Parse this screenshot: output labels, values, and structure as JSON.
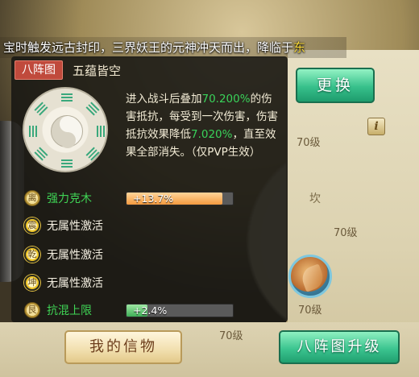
{
  "banner": {
    "text_before": "宝时触发远古封印，三界妖王的元神冲天而出，降临于",
    "text_highlight": "东"
  },
  "formation": {
    "tag": "八阵图",
    "name": "五蕴皆空"
  },
  "description": {
    "part1": "进入战斗后叠加",
    "value1": "70.200%",
    "part2": "的伤害抵抗，每受到一次伤害，伤害抵抗效果降低",
    "value2": "7.020%",
    "part3": "，直至效果全部消失。（仅PVP生效）"
  },
  "effects": [
    {
      "glyph": "离",
      "label": "强力克木",
      "value": "+13.7%",
      "level_fraction": 0.9,
      "color": "orange",
      "active": false
    },
    {
      "glyph": "震",
      "label": "无属性激活",
      "active": true
    },
    {
      "glyph": "乾",
      "label": "无属性激活",
      "active": true
    },
    {
      "glyph": "坤",
      "label": "无属性激活",
      "active": true
    },
    {
      "glyph": "艮",
      "label": "抗混上限",
      "value": "+2.4%",
      "level_fraction": 0.2,
      "color": "green",
      "active": false
    }
  ],
  "background": {
    "level_labels": [
      "70级",
      "70级",
      "70级",
      "70级",
      "70级"
    ],
    "side_char": "坎",
    "partial_text": "70"
  },
  "buttons": {
    "change": "更换",
    "my_faith": "我的信物",
    "upgrade": "八阵图升级",
    "info": "i"
  },
  "colors": {
    "highlight_green": "#39d25a",
    "tag_red": "#c04a3c",
    "button_green": "#37c08b"
  }
}
